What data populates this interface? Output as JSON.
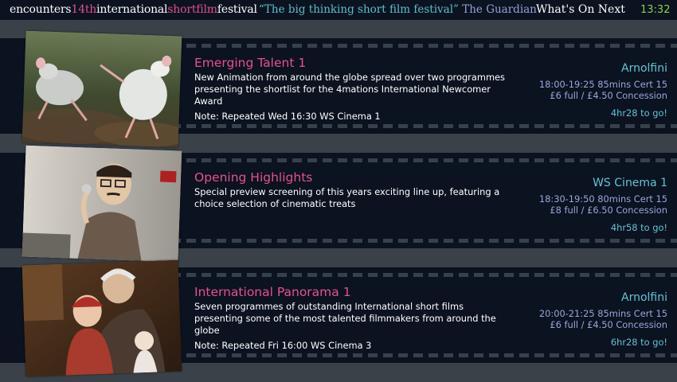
{
  "header": {
    "brand": {
      "part1": "encounters",
      "part2": "14th",
      "part3": "international",
      "part4": "shortfilm",
      "part5": "festival"
    },
    "quote": "“The big thinking short film festival”",
    "quote_source": "The Guardian",
    "section_title": "What's On Next",
    "clock": "13:32"
  },
  "colors": {
    "background": "#3a4149",
    "strip": "#0b1220",
    "title_pink": "#e7508c",
    "venue_cyan": "#5cc7d3",
    "details_lavender": "#9aa6da",
    "clock_green": "#7fd64a"
  },
  "events": [
    {
      "title": "Emerging Talent 1",
      "description": "New Animation from around the globe spread over two programmes presenting the shortlist for the 4mations International Newcomer Award",
      "note": "Note: Repeated Wed 16:30 WS Cinema 1",
      "venue": "Arnolfini",
      "times": "18:00-19:25 85mins Cert 15",
      "price": "£6 full / £4.50 Concession",
      "countdown": "4hr28 to go!"
    },
    {
      "title": "Opening Highlights",
      "description": "Special preview screening of this years exciting line up, featuring a choice selection of cinematic treats",
      "note": "",
      "venue": "WS Cinema 1",
      "times": "18:30-19:50 80mins Cert 15",
      "price": "£8 full / £6.50 Concession",
      "countdown": "4hr58 to go!"
    },
    {
      "title": "International Panorama 1",
      "description": "Seven programmes of outstanding International short films presenting some of the most talented filmmakers from around the globe",
      "note": "Note: Repeated Fri 16:00 WS Cinema 3",
      "venue": "Arnolfini",
      "times": "20:00-21:25 85mins Cert 15",
      "price": "£6 full / £4.50 Concession",
      "countdown": "6hr28 to go!"
    }
  ]
}
